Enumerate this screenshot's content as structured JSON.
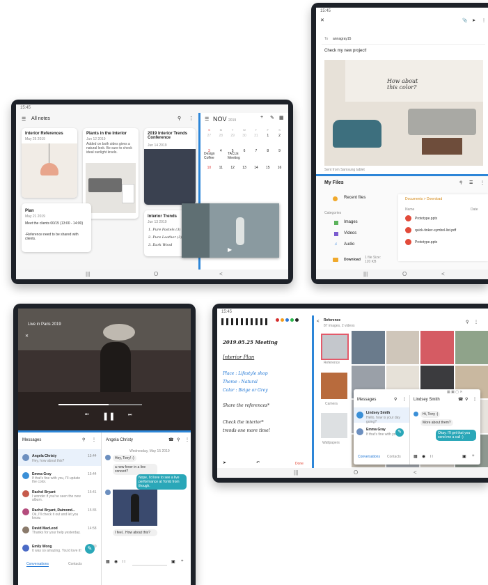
{
  "notes_tablet": {
    "status_time": "15:45",
    "header_title": "All notes",
    "notes": [
      {
        "title": "Interior References",
        "date": "May 25 2019"
      },
      {
        "title": "Plants in the Interior",
        "date": "Jun 12 2019",
        "body": "Added on both sides gives a natural look. Be sure to check ideal sunlight levels."
      },
      {
        "title": "2019 Interior Trends Conference",
        "date": "Jun 14 2019"
      },
      {
        "title": "Plan",
        "date": "May 21 2019",
        "body1": "Meet the clients 00/15 (13:00 - 14:00)",
        "body2": "-Reference need to be shared with clients."
      },
      {
        "title": "Interior Trends",
        "date": "Jun 13 2019",
        "list": [
          "1. Pure Pastels (3)",
          "2. Pure Leather (3)",
          "3. Dark Wood"
        ]
      }
    ],
    "calendar": {
      "month": "NOV",
      "year": "2019",
      "weekdays": [
        "S",
        "M",
        "T",
        "W",
        "T",
        "F",
        "S"
      ],
      "rows": [
        [
          "27",
          "28",
          "29",
          "30",
          "31",
          "1",
          "2"
        ],
        [
          "3",
          "4",
          "5",
          "6",
          "7",
          "8",
          "9"
        ],
        [
          "10",
          "11",
          "12",
          "13",
          "14",
          "15",
          "16"
        ]
      ],
      "events": [
        "Design Coffee",
        "TACLE Meeting"
      ]
    },
    "nav": [
      "|||",
      "O",
      "<"
    ]
  },
  "email_tablet": {
    "status_time": "15:45",
    "to_label": "To",
    "to_value": "annagray15",
    "subject": "Check my new project!",
    "handwriting": "How about this color?",
    "sent_from": "Sent from Samsung tablet",
    "files": {
      "title": "My Files",
      "recent": "Recent files",
      "categories_label": "Categories",
      "categories": [
        "Images",
        "Videos",
        "Audio"
      ],
      "download_label": "Download",
      "download_info": "1 file Size: 120 KB",
      "breadcrumb": "Documents > Download",
      "col_name": "Name",
      "col_date": "Date",
      "file_list": [
        "Prototype.pptx",
        "quick-tinker-symbol-list.pdf",
        "Prototype.pptx"
      ]
    },
    "nav": [
      "|||",
      "O",
      "<"
    ]
  },
  "video_tablet": {
    "video_title": "Live in Paris 2019",
    "messages_title": "Messages",
    "contacts": [
      {
        "name": "Angela Christy",
        "preview": "Hey, how about this?",
        "time": "15:44"
      },
      {
        "name": "Emma Gray",
        "preview": "If that's fine with you, I'll update the color.",
        "time": "15:44"
      },
      {
        "name": "Rachel Bryant",
        "preview": "I wonder if you've seen the new album.",
        "time": "15:41"
      },
      {
        "name": "Rachel Bryant, Raimond...",
        "preview": "Ok, I'll check it out and let you know.",
        "time": "15:35"
      },
      {
        "name": "David MacLeod",
        "preview": "Thanks for your help yesterday.",
        "time": "14:58"
      },
      {
        "name": "Emily Wong",
        "preview": "It was so amazing. You'd love it!",
        "time": "14:30"
      }
    ],
    "tabs": [
      "Conversations",
      "Contacts"
    ],
    "chat_name": "Angela Christy",
    "chat_date": "Wednesday, May 15 2019",
    "chat_bubbles": [
      "Hey, Tony! :)",
      "a new fever in a live concert?",
      "Nope, I'd love to see a live performance at Tomb from though.",
      "I feel.. How about this?"
    ],
    "nav": [
      "|||",
      "O",
      "<"
    ]
  },
  "note_ref_tablet": {
    "status_time": "15:45",
    "note_date": "2019.05.25 Meeting",
    "note_heading": "Interior Plan",
    "note_lines": [
      "Place : Lifestyle shop",
      "Theme : Natural",
      "Color : Beige or Grey"
    ],
    "note_share": "Share the references*",
    "note_check1": "Check the interior*",
    "note_check2": "trends one more time!",
    "done_label": "Done",
    "gallery_title": "Reference",
    "gallery_sub": "87 images, 2 videos",
    "gallery_albums": [
      "Reference",
      "Camera",
      "Wallpapers"
    ],
    "popup": {
      "messages_title": "Messages",
      "chat_name": "Lindsey Smith",
      "contacts": [
        {
          "name": "Lindsey Smith",
          "preview": "Hello, how is your day going?"
        },
        {
          "name": "Emma Gray",
          "preview": "If that's fine with you..."
        }
      ],
      "tabs": [
        "Conversations",
        "Contacts"
      ],
      "bubbles": [
        "Hi, Tony :)",
        "More about them?",
        "Okay. I'll get that you send me a call :)"
      ]
    },
    "nav": [
      "|||",
      "O",
      "<"
    ]
  }
}
